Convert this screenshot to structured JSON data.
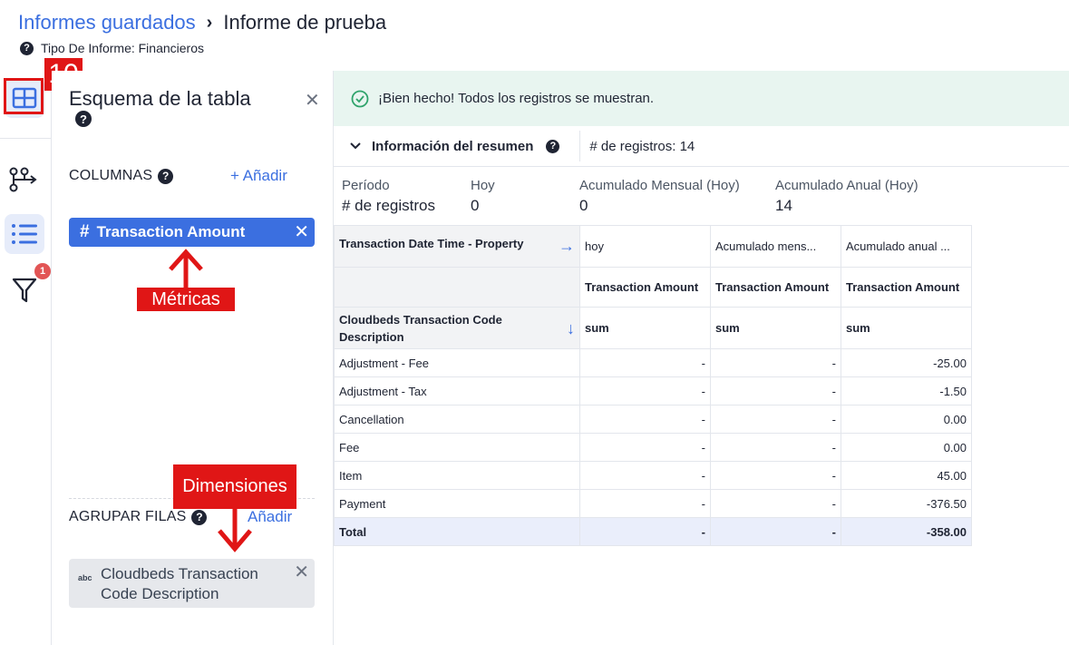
{
  "breadcrumb": {
    "parent": "Informes guardados",
    "separator": "›",
    "current": "Informe de prueba"
  },
  "subtitle": "Tipo De Informe: Financieros",
  "annotation_number": "10",
  "rail": {
    "filter_badge": "1"
  },
  "schema_panel": {
    "title": "Esquema de la tabla",
    "columns_label": "COLUMNAS",
    "add_label": "+ Añadir",
    "metric_chip": "Transaction Amount",
    "group_rows_label": "AGRUPAR FILAS",
    "group_add_label": "Añadir",
    "dimension_chip": "Cloudbeds Transaction Code Description",
    "dimension_type": "abc"
  },
  "annotations": {
    "metrics": "Métricas",
    "dimensions": "Dimensiones"
  },
  "success_message": "¡Bien hecho! Todos los registros se muestran.",
  "summary": {
    "title": "Información del resumen",
    "count": "# de registros: 14",
    "stats": [
      {
        "label": "Período",
        "value": "# de registros"
      },
      {
        "label": "Hoy",
        "value": "0"
      },
      {
        "label": "Acumulado Mensual (Hoy)",
        "value": "0"
      },
      {
        "label": "Acumulado Anual (Hoy)",
        "value": "14"
      }
    ]
  },
  "table": {
    "pivot_header": "Transaction Date Time - Property",
    "period_headers": [
      "hoy",
      "Acumulado mens...",
      "Acumulado anual ..."
    ],
    "metric_header": "Transaction Amount",
    "row_header": "Cloudbeds Transaction Code Description",
    "agg": "sum",
    "rows": [
      {
        "label": "Adjustment - Fee",
        "values": [
          "-",
          "-",
          "-25.00"
        ]
      },
      {
        "label": "Adjustment - Tax",
        "values": [
          "-",
          "-",
          "-1.50"
        ]
      },
      {
        "label": "Cancellation",
        "values": [
          "-",
          "-",
          "0.00"
        ]
      },
      {
        "label": "Fee",
        "values": [
          "-",
          "-",
          "0.00"
        ]
      },
      {
        "label": "Item",
        "values": [
          "-",
          "-",
          "45.00"
        ]
      },
      {
        "label": "Payment",
        "values": [
          "-",
          "-",
          "-376.50"
        ]
      }
    ],
    "total": {
      "label": "Total",
      "values": [
        "-",
        "-",
        "-358.00"
      ]
    }
  },
  "colors": {
    "accent": "#3b6fe0",
    "annotation": "#e01616",
    "success_bg": "#e8f5f0"
  }
}
